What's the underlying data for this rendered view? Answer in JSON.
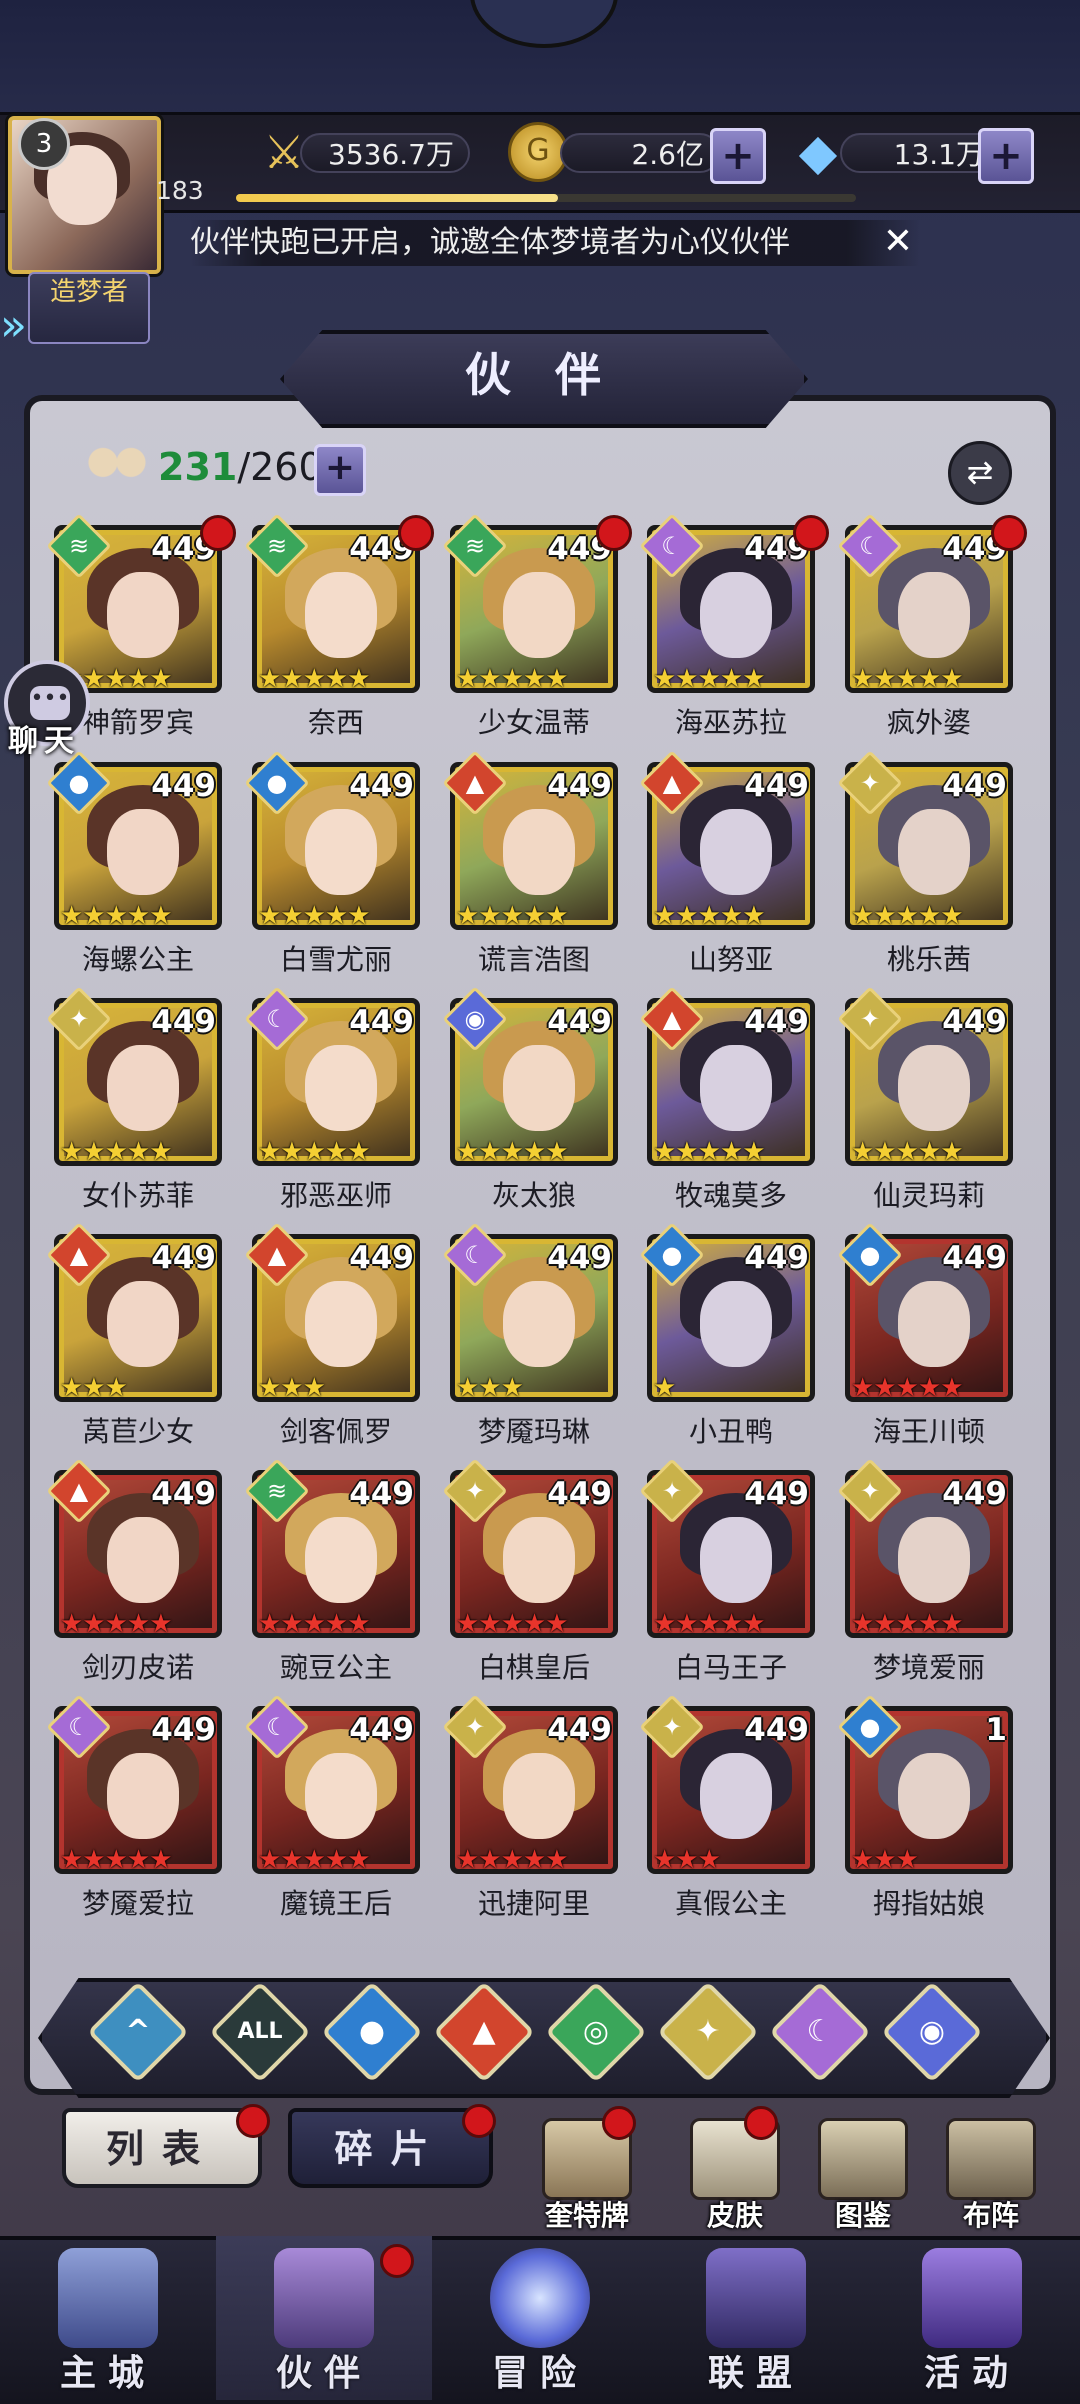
{
  "resources": {
    "player_level": "3",
    "exp_value": "183",
    "exp_progress": 0.52,
    "power": "3536.7万",
    "gold": "2.6亿",
    "diamond": "13.1万"
  },
  "title_badge": "造梦者",
  "marquee_text": "伙伴快跑已开启，诚邀全体梦境者为心仪伙伴",
  "panel_title": "伙 伴",
  "partner_count": {
    "current": "231",
    "max": "/260"
  },
  "chat_label": "聊天",
  "partners": [
    {
      "name": "神箭罗宾",
      "level": "449",
      "element": "wind",
      "stars": 5,
      "tier": "gold",
      "dot": true
    },
    {
      "name": "奈西",
      "level": "449",
      "element": "wind",
      "stars": 5,
      "tier": "gold",
      "dot": true
    },
    {
      "name": "少女温蒂",
      "level": "449",
      "element": "wind",
      "stars": 5,
      "tier": "gold",
      "dot": true
    },
    {
      "name": "海巫苏拉",
      "level": "449",
      "element": "moon",
      "stars": 5,
      "tier": "gold",
      "dot": true
    },
    {
      "name": "疯外婆",
      "level": "449",
      "element": "moon",
      "stars": 5,
      "tier": "gold",
      "dot": true
    },
    {
      "name": "海螺公主",
      "level": "449",
      "element": "water",
      "stars": 5,
      "tier": "gold",
      "dot": false
    },
    {
      "name": "白雪尤丽",
      "level": "449",
      "element": "water",
      "stars": 5,
      "tier": "gold",
      "dot": false
    },
    {
      "name": "谎言浩图",
      "level": "449",
      "element": "fire",
      "stars": 5,
      "tier": "gold",
      "dot": false
    },
    {
      "name": "山努亚",
      "level": "449",
      "element": "fire",
      "stars": 5,
      "tier": "gold",
      "dot": false
    },
    {
      "name": "桃乐茜",
      "level": "449",
      "element": "light",
      "stars": 5,
      "tier": "gold",
      "dot": false
    },
    {
      "name": "女仆苏菲",
      "level": "449",
      "element": "light",
      "stars": 5,
      "tier": "gold",
      "dot": false
    },
    {
      "name": "邪恶巫师",
      "level": "449",
      "element": "moon",
      "stars": 5,
      "tier": "gold",
      "dot": false
    },
    {
      "name": "灰太狼",
      "level": "449",
      "element": "planet",
      "stars": 5,
      "tier": "gold",
      "dot": false
    },
    {
      "name": "牧魂莫多",
      "level": "449",
      "element": "fire",
      "stars": 5,
      "tier": "gold",
      "dot": false
    },
    {
      "name": "仙灵玛莉",
      "level": "449",
      "element": "light",
      "stars": 5,
      "tier": "gold",
      "dot": false
    },
    {
      "name": "莴苣少女",
      "level": "449",
      "element": "fire",
      "stars": 3,
      "tier": "gold",
      "dot": false
    },
    {
      "name": "剑客佩罗",
      "level": "449",
      "element": "fire",
      "stars": 3,
      "tier": "gold",
      "dot": false
    },
    {
      "name": "梦魇玛琳",
      "level": "449",
      "element": "moon",
      "stars": 3,
      "tier": "gold",
      "dot": false
    },
    {
      "name": "小丑鸭",
      "level": "449",
      "element": "water",
      "stars": 1,
      "tier": "gold",
      "dot": false
    },
    {
      "name": "海王川顿",
      "level": "449",
      "element": "water",
      "stars": 5,
      "tier": "red",
      "dot": false
    },
    {
      "name": "剑刃皮诺",
      "level": "449",
      "element": "fire",
      "stars": 5,
      "tier": "red",
      "dot": false
    },
    {
      "name": "豌豆公主",
      "level": "449",
      "element": "wind",
      "stars": 5,
      "tier": "red",
      "dot": false
    },
    {
      "name": "白棋皇后",
      "level": "449",
      "element": "light",
      "stars": 5,
      "tier": "red",
      "dot": false
    },
    {
      "name": "白马王子",
      "level": "449",
      "element": "light",
      "stars": 5,
      "tier": "red",
      "dot": false
    },
    {
      "name": "梦境爱丽",
      "level": "449",
      "element": "light",
      "stars": 5,
      "tier": "red",
      "dot": false
    },
    {
      "name": "梦魇爱拉",
      "level": "449",
      "element": "moon",
      "stars": 5,
      "tier": "red",
      "dot": false
    },
    {
      "name": "魔镜王后",
      "level": "449",
      "element": "moon",
      "stars": 5,
      "tier": "red",
      "dot": false
    },
    {
      "name": "迅捷阿里",
      "level": "449",
      "element": "light",
      "stars": 5,
      "tier": "red",
      "dot": false
    },
    {
      "name": "真假公主",
      "level": "449",
      "element": "light",
      "stars": 3,
      "tier": "red",
      "dot": false
    },
    {
      "name": "拇指姑娘",
      "level": "1",
      "element": "water",
      "stars": 3,
      "tier": "red",
      "dot": false
    }
  ],
  "filters": [
    {
      "name": "wind",
      "glyph": "^"
    },
    {
      "name": "all",
      "glyph": "ALL"
    },
    {
      "name": "water",
      "glyph": "●"
    },
    {
      "name": "fire",
      "glyph": "▲"
    },
    {
      "name": "wind-green",
      "glyph": "◎"
    },
    {
      "name": "light",
      "glyph": "✦"
    },
    {
      "name": "moon",
      "glyph": "☾"
    },
    {
      "name": "planet",
      "glyph": "◉"
    }
  ],
  "tabs": {
    "list": "列表",
    "fragments": "碎片"
  },
  "tools": {
    "cards": "奎特牌",
    "skins": "皮肤",
    "gallery": "图鉴",
    "formation": "布阵"
  },
  "nav": {
    "city": "主城",
    "partner": "伙伴",
    "adventure": "冒险",
    "alliance": "联盟",
    "events": "活动"
  },
  "colors": {
    "wind": "#3aa65a",
    "water": "#2f7fd0",
    "fire": "#d2452d",
    "light": "#c9b24a",
    "moon": "#a56bd6",
    "planet": "#5a6ad8",
    "all": "#2a3a3a"
  }
}
